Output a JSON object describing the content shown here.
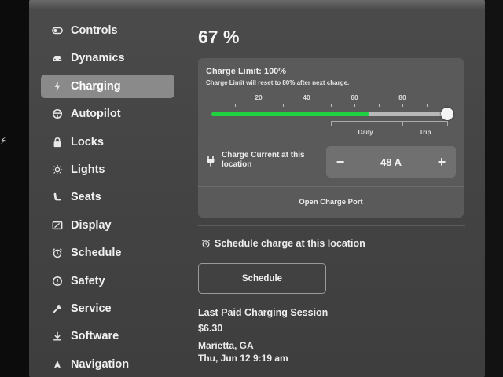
{
  "sidebar": {
    "items": [
      {
        "label": "Controls",
        "icon": "toggle-icon",
        "active": false
      },
      {
        "label": "Dynamics",
        "icon": "car-icon",
        "active": false
      },
      {
        "label": "Charging",
        "icon": "bolt-icon",
        "active": true
      },
      {
        "label": "Autopilot",
        "icon": "steering-wheel-icon",
        "active": false
      },
      {
        "label": "Locks",
        "icon": "lock-icon",
        "active": false
      },
      {
        "label": "Lights",
        "icon": "sun-icon",
        "active": false
      },
      {
        "label": "Seats",
        "icon": "seat-icon",
        "active": false
      },
      {
        "label": "Display",
        "icon": "display-icon",
        "active": false
      },
      {
        "label": "Schedule",
        "icon": "alarm-clock-icon",
        "active": false
      },
      {
        "label": "Safety",
        "icon": "alert-icon",
        "active": false
      },
      {
        "label": "Service",
        "icon": "wrench-icon",
        "active": false
      },
      {
        "label": "Software",
        "icon": "download-icon",
        "active": false
      },
      {
        "label": "Navigation",
        "icon": "navigation-arrow-icon",
        "active": false
      }
    ]
  },
  "charging": {
    "battery_percent": "67 %",
    "charge_limit_title": "Charge Limit: 100%",
    "charge_limit_note": "Charge Limit will reset to 80% after next charge.",
    "slider_ticks": [
      "20",
      "40",
      "60",
      "80"
    ],
    "battery_level_fraction": 0.67,
    "charge_limit_fraction": 1.0,
    "daily_label": "Daily",
    "trip_label": "Trip",
    "current_label": "Charge Current at this location",
    "current_value": "48 A",
    "minus": "−",
    "plus": "+",
    "open_port_label": "Open Charge Port",
    "accent_color": "#1fd23f"
  },
  "schedule": {
    "heading": "Schedule charge at this location",
    "button_label": "Schedule"
  },
  "last_session": {
    "title": "Last Paid Charging Session",
    "amount": "$6.30",
    "location": "Marietta, GA",
    "time": "Thu, Jun 12 9:19 am"
  }
}
